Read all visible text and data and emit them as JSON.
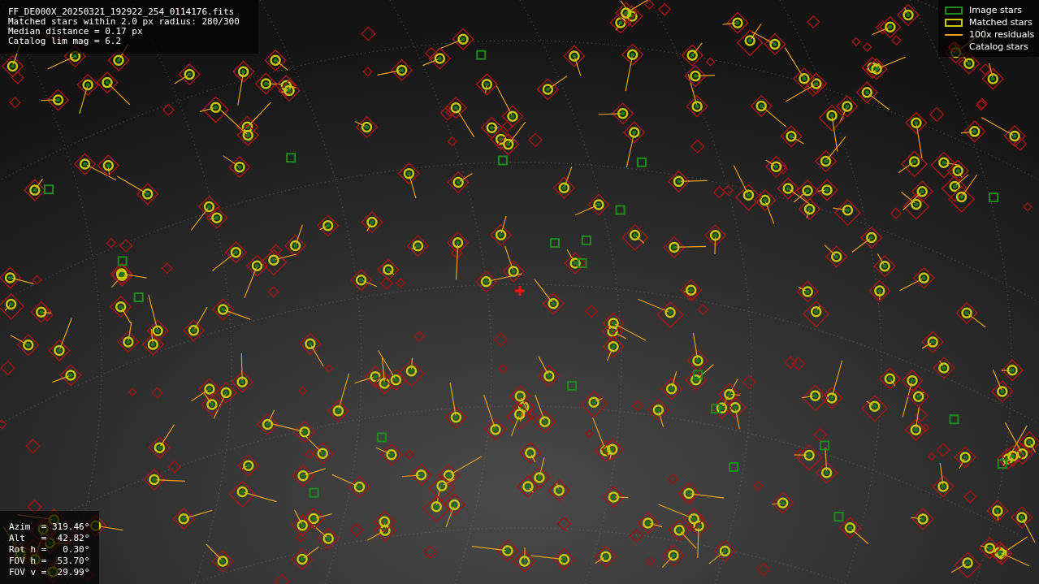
{
  "header": {
    "lines": [
      "FF_DE000X_20250321_192922_254_0114176.fits",
      "Matched stars within 2.0 px radius: 280/300",
      "Median distance = 0.17 px",
      "Catalog lim mag = 6.2"
    ]
  },
  "legend": [
    {
      "label": "Image stars",
      "kind": "image"
    },
    {
      "label": "Matched stars",
      "kind": "matched"
    },
    {
      "label": "100x residuals",
      "kind": "residual"
    },
    {
      "label": "Catalog stars",
      "kind": "catalog"
    }
  ],
  "pointing": {
    "lines": [
      "Azim  = 319.46°",
      "Alt   =  42.82°",
      "Rot h =   0.30°",
      "FOV h =  53.70°",
      "FOV v =  29.99°"
    ]
  }
}
